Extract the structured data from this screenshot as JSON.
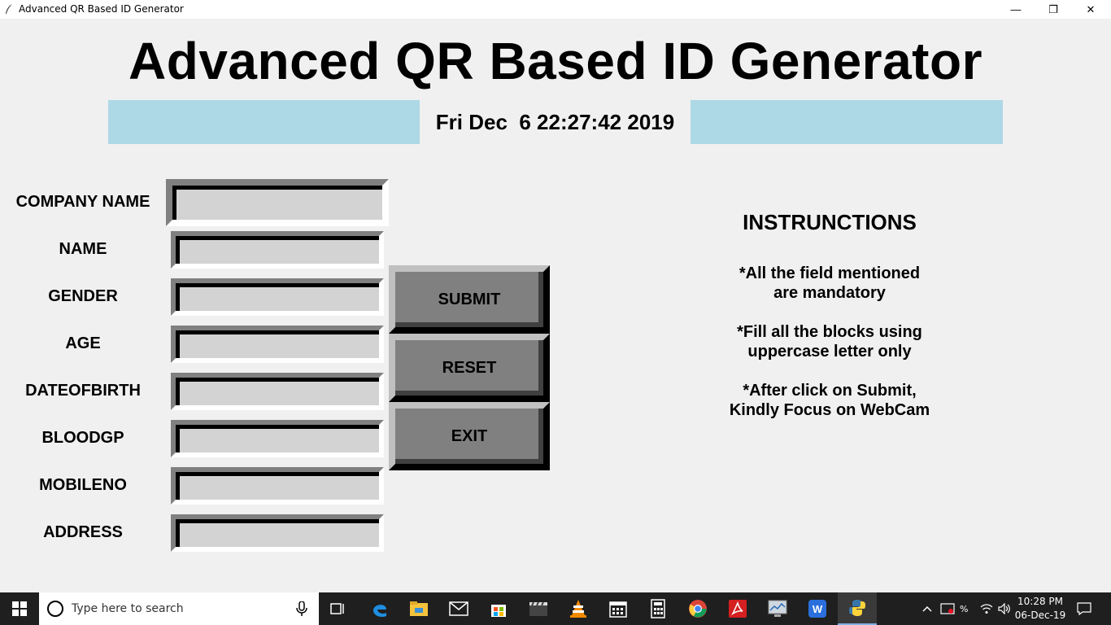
{
  "window": {
    "title": "Advanced QR Based ID Generator",
    "minimize_label": "—",
    "maximize_label": "❐",
    "close_label": "✕"
  },
  "header": {
    "heading": "Advanced QR Based ID Generator",
    "clock": "Fri Dec  6 22:27:42 2019",
    "band_color": "#add8e6"
  },
  "form": {
    "fields": [
      {
        "label": "COMPANY NAME",
        "value": ""
      },
      {
        "label": "NAME",
        "value": ""
      },
      {
        "label": "GENDER",
        "value": ""
      },
      {
        "label": "AGE",
        "value": ""
      },
      {
        "label": "DATEOFBIRTH",
        "value": ""
      },
      {
        "label": "BLOODGP",
        "value": ""
      },
      {
        "label": "MOBILENO",
        "value": ""
      },
      {
        "label": "ADDRESS",
        "value": ""
      }
    ]
  },
  "buttons": {
    "submit": "SUBMIT",
    "reset": "RESET",
    "exit": "EXIT"
  },
  "instructions": {
    "title": "INSTRUNCTIONS",
    "items": [
      "*All the field mentioned\nare mandatory",
      "*Fill all the blocks using\nuppercase letter only",
      "*After click on Submit,\nKindly Focus on WebCam"
    ]
  },
  "taskbar": {
    "search_placeholder": "Type here to search",
    "time": "10:28 PM",
    "date": "06-Dec-19",
    "apps": [
      "task-view-icon",
      "edge-icon",
      "file-explorer-icon",
      "mail-icon",
      "store-icon",
      "movies-icon",
      "vlc-icon",
      "calendar-icon",
      "calculator-icon",
      "chrome-icon",
      "acrobat-icon",
      "system-monitor-icon",
      "wps-office-icon",
      "python-icon"
    ]
  }
}
